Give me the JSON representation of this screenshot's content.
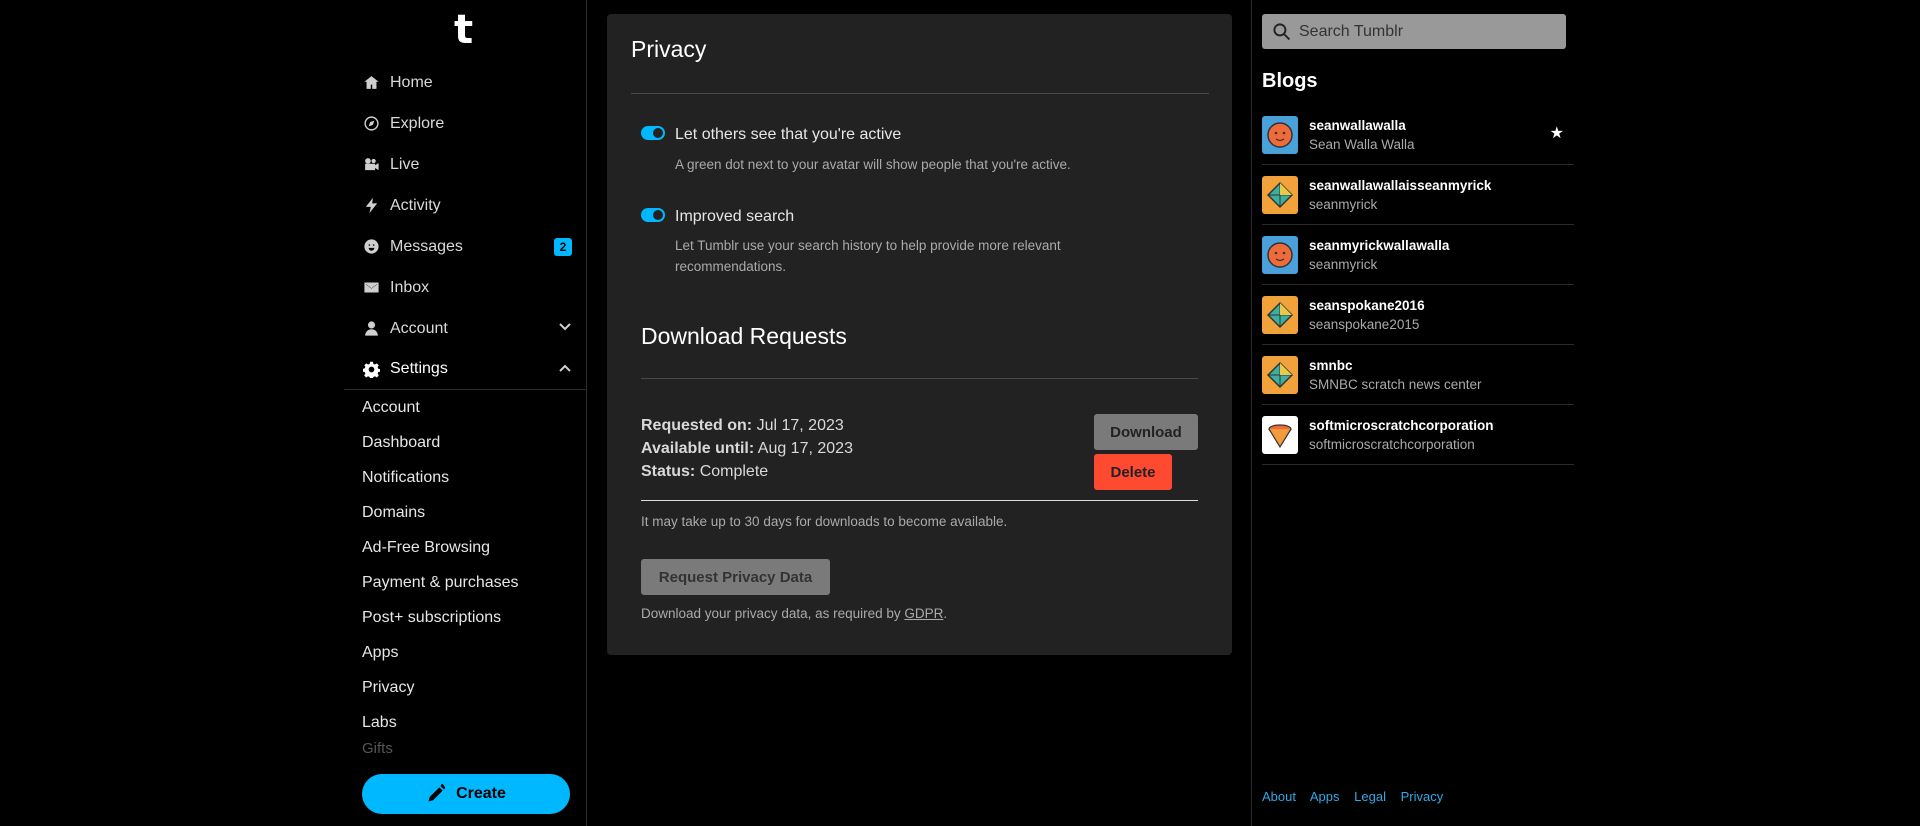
{
  "app": {
    "logo": "t"
  },
  "nav": {
    "items": [
      {
        "label": "Home",
        "icon": "home-icon"
      },
      {
        "label": "Explore",
        "icon": "compass-icon"
      },
      {
        "label": "Live",
        "icon": "video-icon"
      },
      {
        "label": "Activity",
        "icon": "lightning-icon"
      },
      {
        "label": "Messages",
        "icon": "smiley-icon",
        "badge": "2"
      },
      {
        "label": "Inbox",
        "icon": "envelope-icon"
      },
      {
        "label": "Account",
        "icon": "person-icon"
      },
      {
        "label": "Settings",
        "icon": "gear-icon"
      }
    ],
    "settings_items": [
      "Account",
      "Dashboard",
      "Notifications",
      "Domains",
      "Ad-Free Browsing",
      "Payment & purchases",
      "Post+ subscriptions",
      "Apps",
      "Privacy",
      "Labs",
      "Gifts"
    ],
    "create_label": "Create"
  },
  "privacy": {
    "title": "Privacy",
    "toggles": [
      {
        "label": "Let others see that you're active",
        "description": "A green dot next to your avatar will show people that you're active.",
        "on": true
      },
      {
        "label": "Improved search",
        "description": "Let Tumblr use your search history to help provide more relevant recommendations.",
        "on": true
      }
    ]
  },
  "download": {
    "title": "Download Requests",
    "requested_label": "Requested on:",
    "requested_value": "Jul 17, 2023",
    "available_label": "Available until:",
    "available_value": "Aug 17, 2023",
    "status_label": "Status:",
    "status_value": "Complete",
    "download_button": "Download",
    "delete_button": "Delete",
    "note": "It may take up to 30 days for downloads to become available.",
    "request_button": "Request Privacy Data",
    "gdpr_prefix": "Download your privacy data, as required by ",
    "gdpr_link": "GDPR",
    "gdpr_suffix": "."
  },
  "right": {
    "search_placeholder": "Search Tumblr",
    "blogs_title": "Blogs",
    "blogs": [
      {
        "name": "seanwallawalla",
        "title": "Sean Walla Walla",
        "avatar": "blue-face",
        "starred": true
      },
      {
        "name": "seanwallawallaisseanmyrick",
        "title": "seanmyrick",
        "avatar": "orange-diamond"
      },
      {
        "name": "seanmyrickwallawalla",
        "title": "seanmyrick",
        "avatar": "blue-face"
      },
      {
        "name": "seanspokane2016",
        "title": "seanspokane2015",
        "avatar": "orange-diamond"
      },
      {
        "name": "smnbc",
        "title": "SMNBC scratch news center",
        "avatar": "orange-diamond"
      },
      {
        "name": "softmicroscratchcorporation",
        "title": "softmicroscratchcorporation",
        "avatar": "white-cone"
      }
    ],
    "star_glyph": "★",
    "footer": [
      "About",
      "Apps",
      "Legal",
      "Privacy"
    ]
  },
  "colors": {
    "accent": "#00b8ff",
    "danger": "#ff4930",
    "panel": "#222222",
    "link": "#2fa9e8"
  }
}
